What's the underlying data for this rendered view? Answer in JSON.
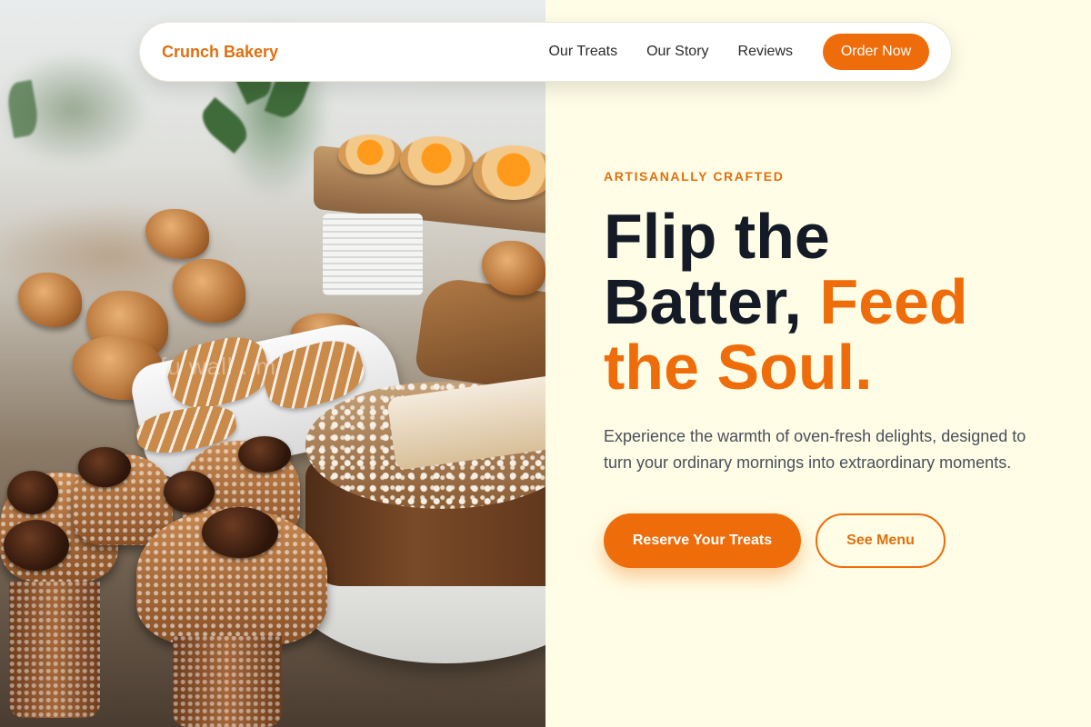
{
  "nav": {
    "brand": "Crunch Bakery",
    "links": [
      "Our Treats",
      "Our Story",
      "Reviews"
    ],
    "order_button": "Order Now"
  },
  "hero": {
    "eyebrow": "ARTISANALLY CRAFTED",
    "headline_line1": "Flip the",
    "headline_line2_dark": "Batter, ",
    "headline_line2_accent": "Feed",
    "headline_line3_accent": "the Soul.",
    "lead": "Experience the warmth of oven-fresh delights, designed to turn your ordinary mornings into extraordinary moments.",
    "primary_cta": "Reserve Your Treats",
    "secondary_cta": "See Menu"
  },
  "image": {
    "watermark": "fu  wall   .  m"
  },
  "colors": {
    "accent": "#ef6c0a",
    "brand": "#e07010",
    "headline": "#141a26",
    "background": "#fffde6"
  }
}
